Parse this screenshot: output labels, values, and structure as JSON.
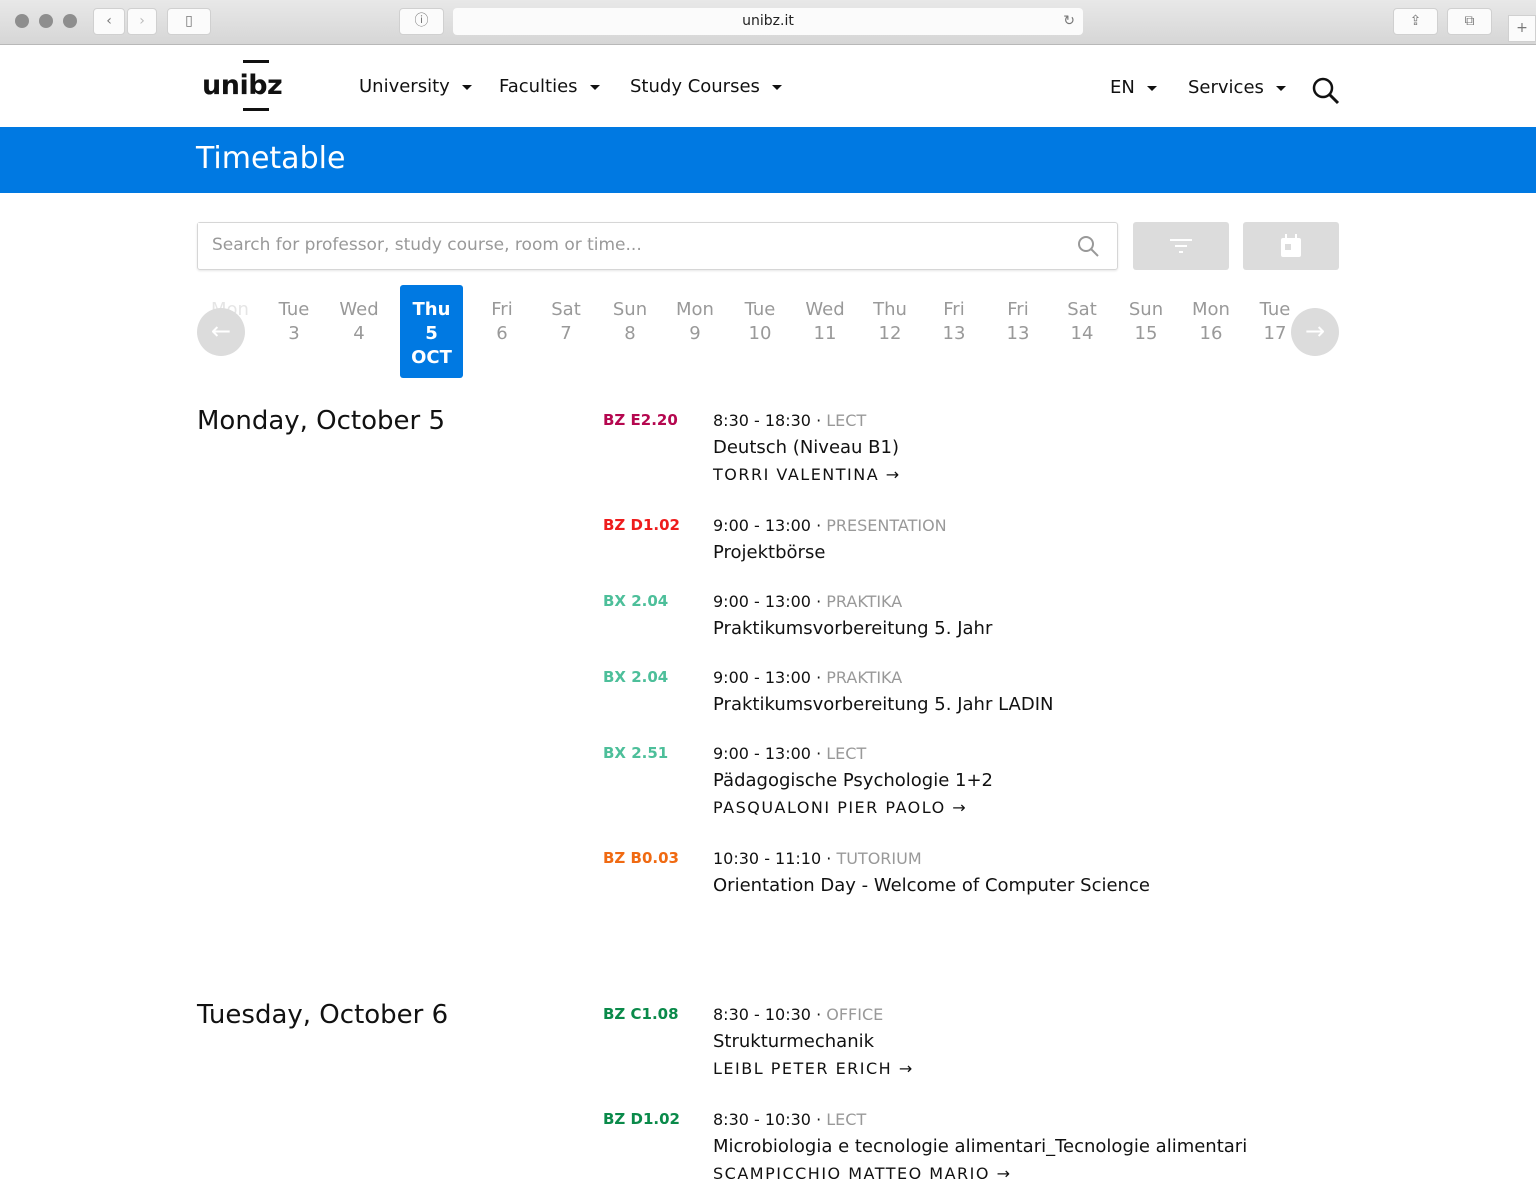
{
  "browser": {
    "url": "unibz.it"
  },
  "header": {
    "logo": "unibz",
    "nav": [
      "University",
      "Faculties",
      "Study Courses"
    ],
    "lang": "EN",
    "services": "Services"
  },
  "banner": {
    "title": "Timetable"
  },
  "search": {
    "placeholder": "Search for professor, study course, room or time..."
  },
  "dates": [
    {
      "wd": "Mon",
      "d": ""
    },
    {
      "wd": "Tue",
      "d": "3"
    },
    {
      "wd": "Wed",
      "d": "4"
    },
    {
      "wd": "Thu",
      "d": "5",
      "m": "OCT",
      "selected": true
    },
    {
      "wd": "Fri",
      "d": "6"
    },
    {
      "wd": "Sat",
      "d": "7"
    },
    {
      "wd": "Sun",
      "d": "8"
    },
    {
      "wd": "Mon",
      "d": "9"
    },
    {
      "wd": "Tue",
      "d": "10"
    },
    {
      "wd": "Wed",
      "d": "11"
    },
    {
      "wd": "Thu",
      "d": "12"
    },
    {
      "wd": "Fri",
      "d": "13"
    },
    {
      "wd": "Fri",
      "d": "13"
    },
    {
      "wd": "Sat",
      "d": "14"
    },
    {
      "wd": "Sun",
      "d": "15"
    },
    {
      "wd": "Mon",
      "d": "16"
    },
    {
      "wd": "Tue",
      "d": "17"
    }
  ],
  "days": [
    {
      "heading": "Monday, October 5",
      "events": [
        {
          "room": "BZ E2.20",
          "color": "#b5074f",
          "time": "8:30 - 18:30",
          "type": "LECT",
          "title": "Deutsch (Niveau B1)",
          "prof": "TORRI VALENTINA"
        },
        {
          "room": "BZ D1.02",
          "color": "#ee1c1c",
          "time": "9:00 - 13:00",
          "type": "PRESENTATION",
          "title": "Projektbörse",
          "prof": ""
        },
        {
          "room": "BX 2.04",
          "color": "#4dbf9a",
          "time": "9:00 - 13:00",
          "type": "PRAKTIKA",
          "title": "Praktikumsvorbereitung 5. Jahr",
          "prof": ""
        },
        {
          "room": "BX 2.04",
          "color": "#4dbf9a",
          "time": "9:00 - 13:00",
          "type": "PRAKTIKA",
          "title": "Praktikumsvorbereitung 5. Jahr LADIN",
          "prof": ""
        },
        {
          "room": "BX 2.51",
          "color": "#4dbf9a",
          "time": "9:00 - 13:00",
          "type": "LECT",
          "title": "Pädagogische Psychologie 1+2",
          "prof": "PASQUALONI PIER PAOLO"
        },
        {
          "room": "BZ B0.03",
          "color": "#f06a12",
          "time": "10:30 - 11:10",
          "type": "TUTORIUM",
          "title": "Orientation Day - Welcome of Computer Science",
          "prof": ""
        }
      ]
    },
    {
      "heading": "Tuesday, October 6",
      "events": [
        {
          "room": "BZ C1.08",
          "color": "#0a8a4a",
          "time": "8:30 - 10:30",
          "type": "OFFICE",
          "title": "Strukturmechanik",
          "prof": "LEIBL PETER ERICH"
        },
        {
          "room": "BZ D1.02",
          "color": "#0a8a4a",
          "time": "8:30 - 10:30",
          "type": "LECT",
          "title": "Microbiologia e tecnologie alimentari_Tecnologie alimentari",
          "prof": "SCAMPICCHIO MATTEO MARIO"
        }
      ]
    }
  ],
  "colors": {
    "accent": "#0079e2"
  }
}
